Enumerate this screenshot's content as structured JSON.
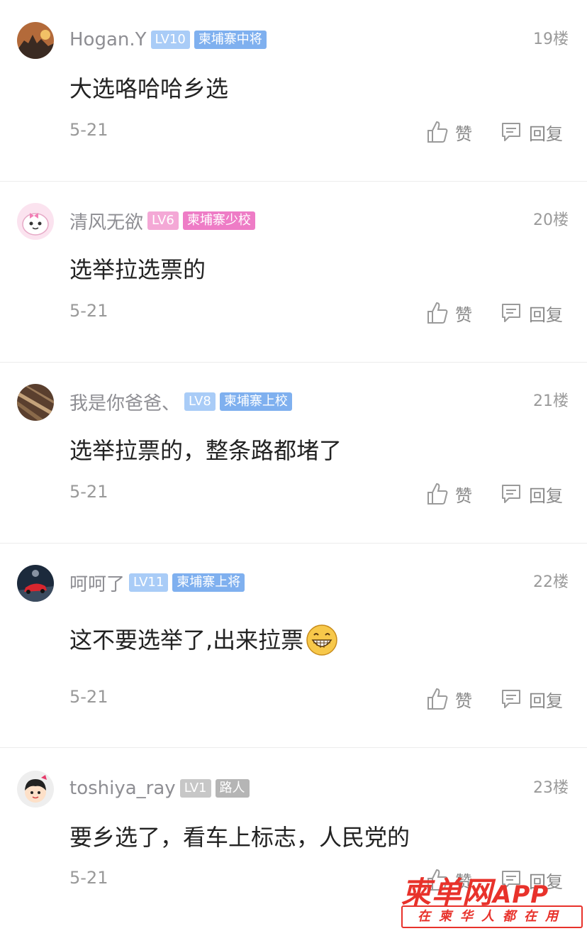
{
  "comments": [
    {
      "username": "Hogan.Y",
      "level": "LV10",
      "title": "柬埔寨中将",
      "floor": "19楼",
      "content": "大选咯哈哈乡选",
      "date": "5-21",
      "like_label": "赞",
      "reply_label": "回复",
      "badge_color": "blue"
    },
    {
      "username": "清风无欲",
      "level": "LV6",
      "title": "柬埔寨少校",
      "floor": "20楼",
      "content": "选举拉选票的",
      "date": "5-21",
      "like_label": "赞",
      "reply_label": "回复",
      "badge_color": "pink"
    },
    {
      "username": "我是你爸爸、",
      "level": "LV8",
      "title": "柬埔寨上校",
      "floor": "21楼",
      "content": "选举拉票的，整条路都堵了",
      "date": "5-21",
      "like_label": "赞",
      "reply_label": "回复",
      "badge_color": "blue"
    },
    {
      "username": "呵呵了",
      "level": "LV11",
      "title": "柬埔寨上将",
      "floor": "22楼",
      "content": "这不要选举了,出来拉票",
      "emoji": "grin-emoji",
      "date": "5-21",
      "like_label": "赞",
      "reply_label": "回复",
      "badge_color": "blue"
    },
    {
      "username": "toshiya_ray",
      "level": "LV1",
      "title": "路人",
      "floor": "23楼",
      "content": "要乡选了，看车上标志，人民党的",
      "date": "5-21",
      "like_label": "赞",
      "reply_label": "回复",
      "badge_color": "gray"
    }
  ],
  "watermark": {
    "brand": "柬单网",
    "app": "APP",
    "tagline": "在柬华人都在用"
  },
  "colors": {
    "badge_blue": "#7fb0ef",
    "badge_pink": "#ee7cc6",
    "badge_gray": "#b5b5b5",
    "brand_red": "#e8322b",
    "text_gray": "#8e8e93"
  }
}
